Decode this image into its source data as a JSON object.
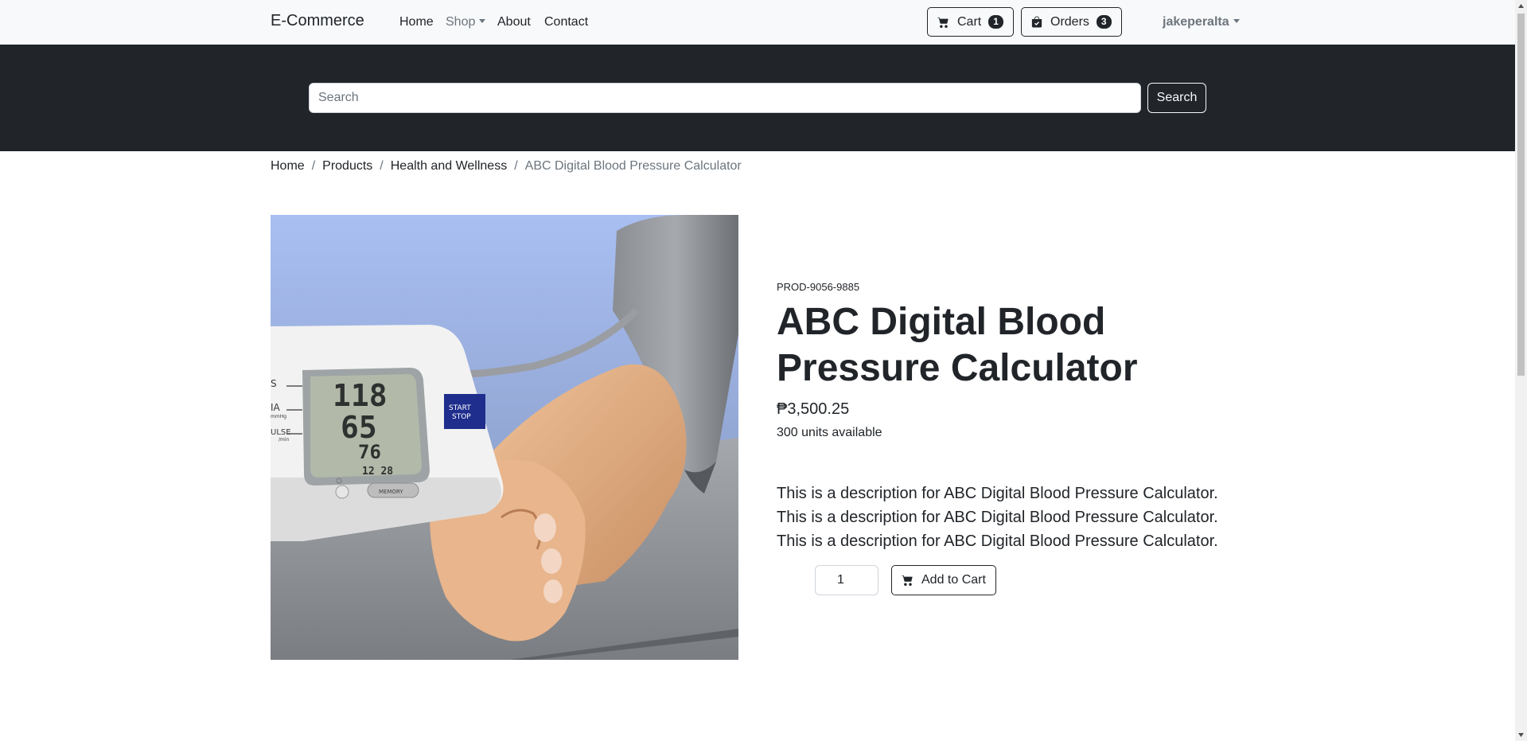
{
  "navbar": {
    "brand": "E-Commerce",
    "links": {
      "home": "Home",
      "shop": "Shop",
      "about": "About",
      "contact": "Contact"
    },
    "cart": {
      "label": "Cart",
      "count": "1"
    },
    "orders": {
      "label": "Orders",
      "count": "3"
    },
    "user": "jakeperalta"
  },
  "search": {
    "placeholder": "Search",
    "value": "",
    "button": "Search"
  },
  "breadcrumb": {
    "home": "Home",
    "products": "Products",
    "category": "Health and Wellness",
    "current": "ABC Digital Blood Pressure Calculator",
    "separator": "/"
  },
  "product": {
    "sku": "PROD-9056-9885",
    "name": "ABC Digital Blood Pressure Calculator",
    "price": "₱3,500.25",
    "stock": "300 units available",
    "description": "This is a description for ABC Digital Blood Pressure Calculator. This is a description for ABC Digital Blood Pressure Calculator. This is a description for ABC Digital Blood Pressure Calculator.",
    "quantity": "1",
    "add_to_cart": "Add to Cart",
    "image_text": {
      "reading_sys": "118",
      "reading_dia": "65",
      "reading_pulse": "76",
      "clock": "12 28",
      "start_stop_1": "START",
      "start_stop_2": "STOP",
      "memory": "MEMORY",
      "label_sys": "S",
      "label_dia": "IA",
      "label_dia_unit": "mmHg",
      "label_pulse": "ULSE",
      "label_pulse_unit": "/min"
    }
  },
  "icons": {
    "cart": "cart-icon",
    "orders": "bag-check-icon"
  }
}
